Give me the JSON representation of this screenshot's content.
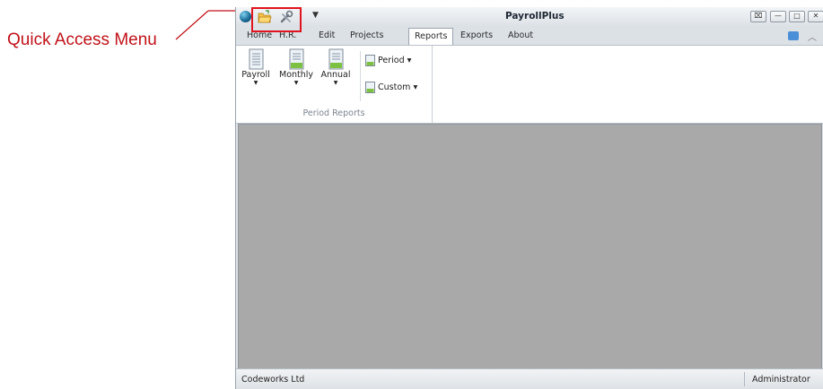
{
  "annotation": {
    "label": "Quick Access Menu",
    "color": "#c0121a"
  },
  "window": {
    "title": "PayrollPlus",
    "quick_access_more": "▼",
    "controls": {
      "restore_alt": "⌧",
      "minimize": "—",
      "maximize": "□",
      "close": "✕"
    }
  },
  "tabs": [
    "Home",
    "H.R.",
    "Edit",
    "Projects",
    "Reports",
    "Exports",
    "About"
  ],
  "active_tab": "Reports",
  "ribbon": {
    "group_label": "Period Reports",
    "big_buttons": [
      {
        "label": "Payroll",
        "icon": "document-icon"
      },
      {
        "label": "Monthly",
        "icon": "document-green-icon"
      },
      {
        "label": "Annual",
        "icon": "document-green-icon"
      }
    ],
    "small_buttons": [
      {
        "label": "Period ▾",
        "icon": "document-small-icon"
      },
      {
        "label": "Custom ▾",
        "icon": "document-small-icon"
      }
    ]
  },
  "status": {
    "company": "Codeworks Ltd",
    "user": "Administrator"
  },
  "icons": {
    "accent": "#1d6f9a",
    "folder": "#e8a21d",
    "doc_green": "#7cc142"
  }
}
